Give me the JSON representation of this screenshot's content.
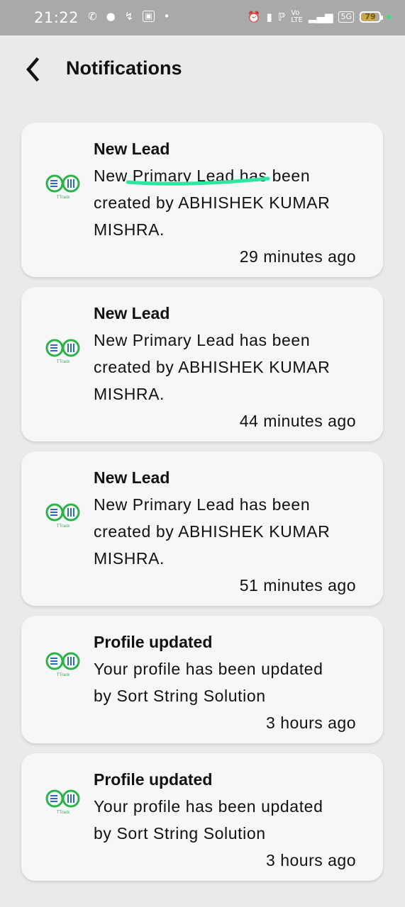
{
  "status_bar": {
    "time": "21:22",
    "battery_level": "79",
    "network_badge": "5G"
  },
  "header": {
    "title": "Notifications"
  },
  "notifications": [
    {
      "title": "New Lead",
      "body_line1": "New Primary Lead has been",
      "body_line2": "created by ABHISHEK KUMAR",
      "body_line3": "MISHRA.",
      "time": "29 minutes ago"
    },
    {
      "title": "New Lead",
      "body_line1": "New Primary Lead has been",
      "body_line2": "created by ABHISHEK KUMAR",
      "body_line3": "MISHRA.",
      "time": "44 minutes ago"
    },
    {
      "title": "New Lead",
      "body_line1": "New Primary Lead has been",
      "body_line2": "created by ABHISHEK KUMAR",
      "body_line3": "MISHRA.",
      "time": "51 minutes ago"
    },
    {
      "title": "Profile updated",
      "body_line1": "Your profile has been updated",
      "body_line2": "by Sort String Solution",
      "time": "3 hours ago"
    },
    {
      "title": "Profile updated",
      "body_line1": "Your profile has been updated",
      "body_line2": "by Sort String Solution",
      "time": "3 hours ago"
    }
  ],
  "logo_text": "TTrack",
  "colors": {
    "logo_green": "#2bb34a",
    "logo_blue": "#2a6fb5",
    "highlight_underline": "#2ee6a0",
    "card_bg": "#f7f7f7",
    "page_bg": "#eaeaea",
    "status_bar_bg": "#a9a9a9"
  },
  "icons": {
    "back": "back-arrow-icon",
    "logo": "ttrack-logo-icon"
  }
}
